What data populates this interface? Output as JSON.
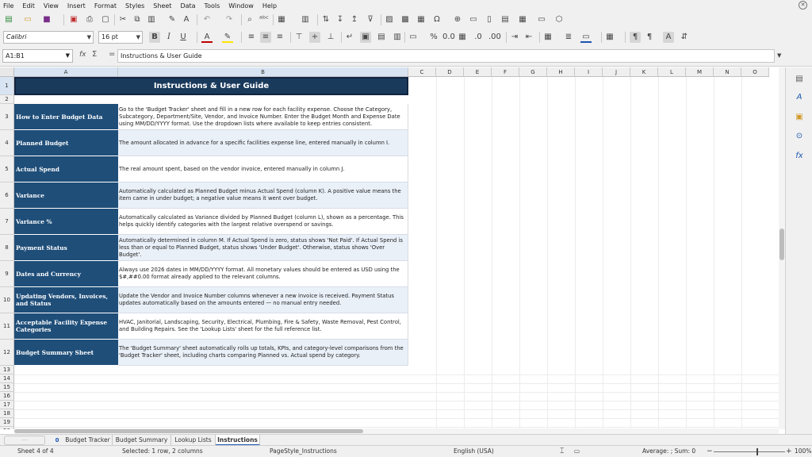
{
  "menu": [
    "File",
    "Edit",
    "View",
    "Insert",
    "Format",
    "Styles",
    "Sheet",
    "Data",
    "Tools",
    "Window",
    "Help"
  ],
  "toolbar": {
    "font_name": "Calibri",
    "font_size": "16 pt"
  },
  "formula_bar": {
    "cell_ref": "A1:B1",
    "content": "Instructions & User Guide"
  },
  "columns": [
    "A",
    "B",
    "C",
    "D",
    "E",
    "F",
    "G",
    "H",
    "I",
    "J",
    "K",
    "L",
    "M",
    "N",
    "O"
  ],
  "rows": [
    "1",
    "2",
    "3",
    "4",
    "5",
    "6",
    "7",
    "8",
    "9",
    "10",
    "11",
    "12",
    "13",
    "14",
    "15",
    "16",
    "17",
    "18",
    "19",
    "20"
  ],
  "sheet": {
    "title": "Instructions & User Guide",
    "items": [
      {
        "label": "How to Enter Budget Data",
        "text": "Go to the 'Budget Tracker' sheet and fill in a new row for each facility expense. Choose the Category, Subcategory, Department/Site, Vendor, and Invoice Number. Enter the Budget Month and Expense Date using MM/DD/YYYY format. Use the dropdown lists where available to keep entries consistent."
      },
      {
        "label": "Planned Budget",
        "text": "The amount allocated in advance for a specific facilities expense line, entered manually in column I."
      },
      {
        "label": "Actual Spend",
        "text": "The real amount spent, based on the vendor invoice, entered manually in column J."
      },
      {
        "label": "Variance",
        "text": "Automatically calculated as Planned Budget minus Actual Spend (column K). A positive value means the item came in under budget; a negative value means it went over budget."
      },
      {
        "label": "Variance %",
        "text": "Automatically calculated as Variance divided by Planned Budget (column L), shown as a percentage. This helps quickly identify categories with the largest relative overspend or savings."
      },
      {
        "label": "Payment Status",
        "text": "Automatically determined in column M. If Actual Spend is zero, status shows 'Not Paid'. If Actual Spend is less than or equal to Planned Budget, status shows 'Under Budget'. Otherwise, status shows 'Over Budget'."
      },
      {
        "label": "Dates and Currency",
        "text": "Always use 2026 dates in MM/DD/YYYY format. All monetary values should be entered as USD using the $#,##0.00 format already applied to the relevant columns."
      },
      {
        "label": "Updating Vendors, Invoices, and Status",
        "text": "Update the Vendor and Invoice Number columns whenever a new invoice is received. Payment Status updates automatically based on the amounts entered — no manual entry needed."
      },
      {
        "label": "Acceptable Facility Expense Categories",
        "text": "HVAC, Janitorial, Landscaping, Security, Electrical, Plumbing, Fire & Safety, Waste Removal, Pest Control, and Building Repairs. See the 'Lookup Lists' sheet for the full reference list."
      },
      {
        "label": "Budget Summary Sheet",
        "text": "The 'Budget Summary' sheet automatically rolls up totals, KPIs, and category-level comparisons from the 'Budget Tracker' sheet, including charts comparing Planned vs. Actual spend by category."
      }
    ]
  },
  "tabs": {
    "zero_badge": "0",
    "sheets": [
      "Budget Tracker",
      "Budget Summary",
      "Lookup Lists",
      "Instructions"
    ],
    "active": "Instructions"
  },
  "status": {
    "sheet_pos": "Sheet 4 of 4",
    "selection": "Selected: 1 row, 2 columns",
    "page_style": "PageStyle_Instructions",
    "language": "English (USA)",
    "summary": "Average: ; Sum: 0",
    "zoom": "100%"
  },
  "colors": {
    "header_fill": "#1a3a5c",
    "label_fill": "#1f4e79",
    "alt_row_fill": "#eaf0f8",
    "selection_accent": "#1a56b0"
  },
  "icons": {
    "toolbar1": [
      "new-icon",
      "open-icon",
      "save-icon",
      "export-pdf-icon",
      "print-icon",
      "print-preview-icon",
      "cut-icon",
      "copy-icon",
      "paste-icon",
      "clone-format-icon",
      "clear-format-icon",
      "undo-icon",
      "redo-icon",
      "find-replace-icon",
      "spelling-icon",
      "row-icon",
      "column-icon",
      "toggle-grid-icon",
      "sort-icon",
      "sort-ascending-icon",
      "sort-descending-icon",
      "autofilter-icon",
      "image-icon",
      "chart-icon",
      "pivot-table-icon",
      "special-character-icon",
      "hyperlink-icon",
      "comment-icon",
      "headers-footers-icon",
      "define-print-area-icon",
      "freeze-icon",
      "split-window-icon",
      "show-draw-functions-icon"
    ],
    "sidebar": [
      "properties-icon",
      "styles-icon",
      "gallery-icon",
      "navigator-icon",
      "functions-icon"
    ]
  }
}
